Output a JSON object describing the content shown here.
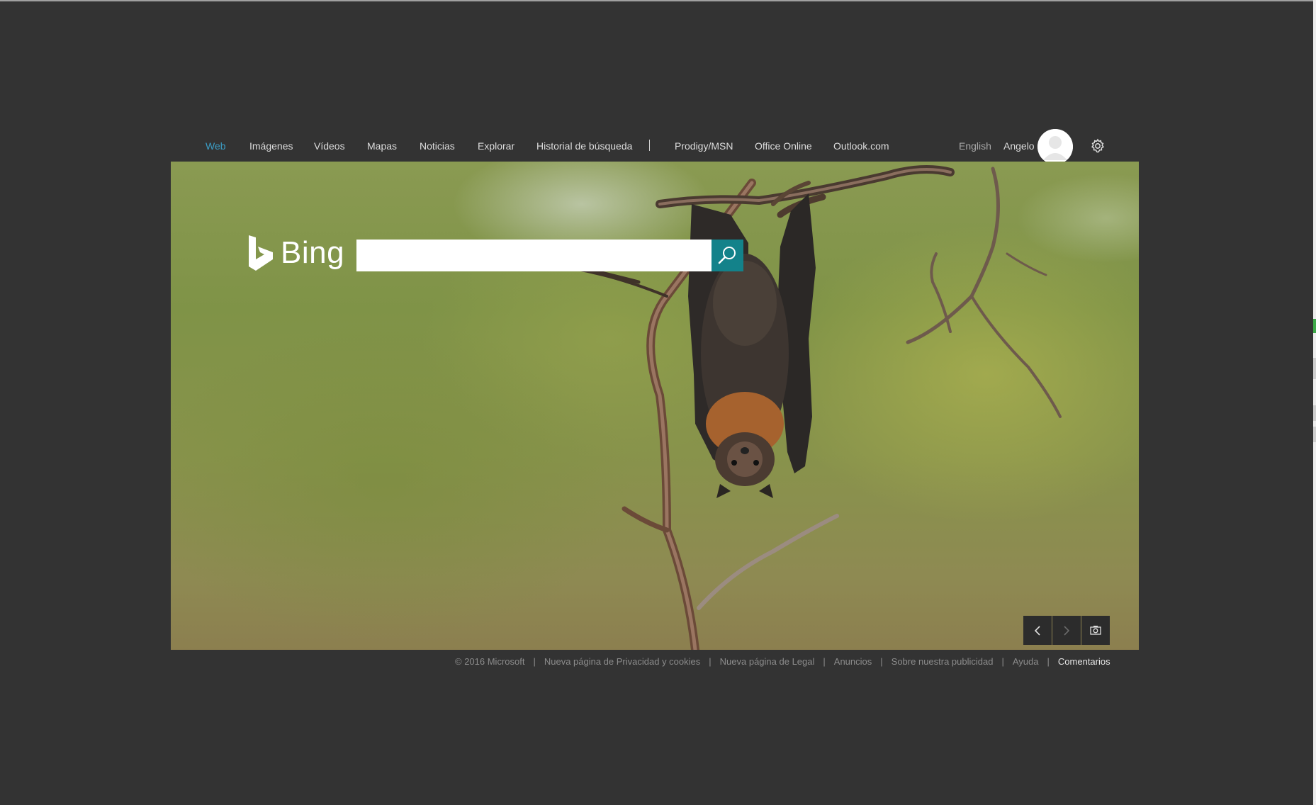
{
  "nav": {
    "items": [
      {
        "label": "Web",
        "active": true
      },
      {
        "label": "Imágenes"
      },
      {
        "label": "Vídeos"
      },
      {
        "label": "Mapas"
      },
      {
        "label": "Noticias"
      },
      {
        "label": "Explorar"
      },
      {
        "label": "Historial de búsqueda"
      }
    ],
    "separator": "|",
    "external": [
      {
        "label": "Prodigy/MSN"
      },
      {
        "label": "Office Online"
      },
      {
        "label": "Outlook.com"
      }
    ],
    "language": "English",
    "user": "Angelo",
    "settings_icon": "gear-icon"
  },
  "logo": {
    "text": "Bing",
    "icon": "bing-b-icon"
  },
  "search": {
    "value": "",
    "placeholder": "",
    "button_icon": "search-icon"
  },
  "image_controls": {
    "prev_icon": "chevron-left-icon",
    "next_icon": "chevron-right-icon",
    "camera_icon": "camera-icon"
  },
  "footer": {
    "items": [
      "© 2016 Microsoft",
      "Nueva página de Privacidad y cookies",
      "Nueva página de Legal",
      "Anuncios",
      "Sobre nuestra publicidad",
      "Ayuda",
      "Comentarios"
    ],
    "separator": "|"
  },
  "colors": {
    "page_bg": "#333333",
    "accent": "#3b9cc4",
    "search_button": "#13828a"
  }
}
